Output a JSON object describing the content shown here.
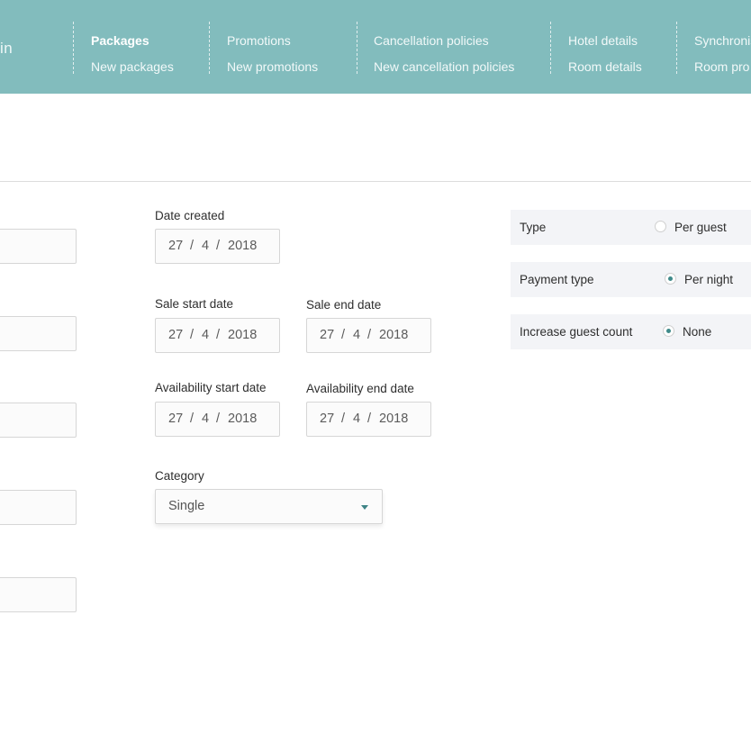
{
  "header": {
    "brand_fragment": "in",
    "nav": [
      {
        "primary": "Packages",
        "secondary": "New packages"
      },
      {
        "primary": "Promotions",
        "secondary": "New promotions"
      },
      {
        "primary": "Cancellation policies",
        "secondary": "New cancellation policies"
      },
      {
        "primary": "Hotel details",
        "secondary": "Room details"
      },
      {
        "primary": "Synchronis",
        "secondary": "Room pro"
      }
    ]
  },
  "form": {
    "date_created": {
      "label": "Date created",
      "day": "27",
      "month": "4",
      "year": "2018"
    },
    "sale_start": {
      "label": "Sale start date",
      "day": "27",
      "month": "4",
      "year": "2018"
    },
    "sale_end": {
      "label": "Sale end date",
      "day": "27",
      "month": "4",
      "year": "2018"
    },
    "availability_start": {
      "label": "Availability start date",
      "day": "27",
      "month": "4",
      "year": "2018"
    },
    "availability_end": {
      "label": "Availability end date",
      "day": "27",
      "month": "4",
      "year": "2018"
    },
    "separator": "/",
    "category": {
      "label": "Category",
      "value": "Single"
    }
  },
  "options": {
    "type": {
      "label": "Type",
      "choice": "Per guest",
      "selected": false
    },
    "payment_type": {
      "label": "Payment type",
      "choice": "Per night",
      "selected": true
    },
    "increase_guest_count": {
      "label": "Increase guest count",
      "choice": "None",
      "selected": true
    }
  },
  "colors": {
    "header_bg": "#82bcbd",
    "accent": "#3f8a8a"
  },
  "icons": {
    "dropdown": "caret-down-icon",
    "radio": "radio-icon"
  }
}
